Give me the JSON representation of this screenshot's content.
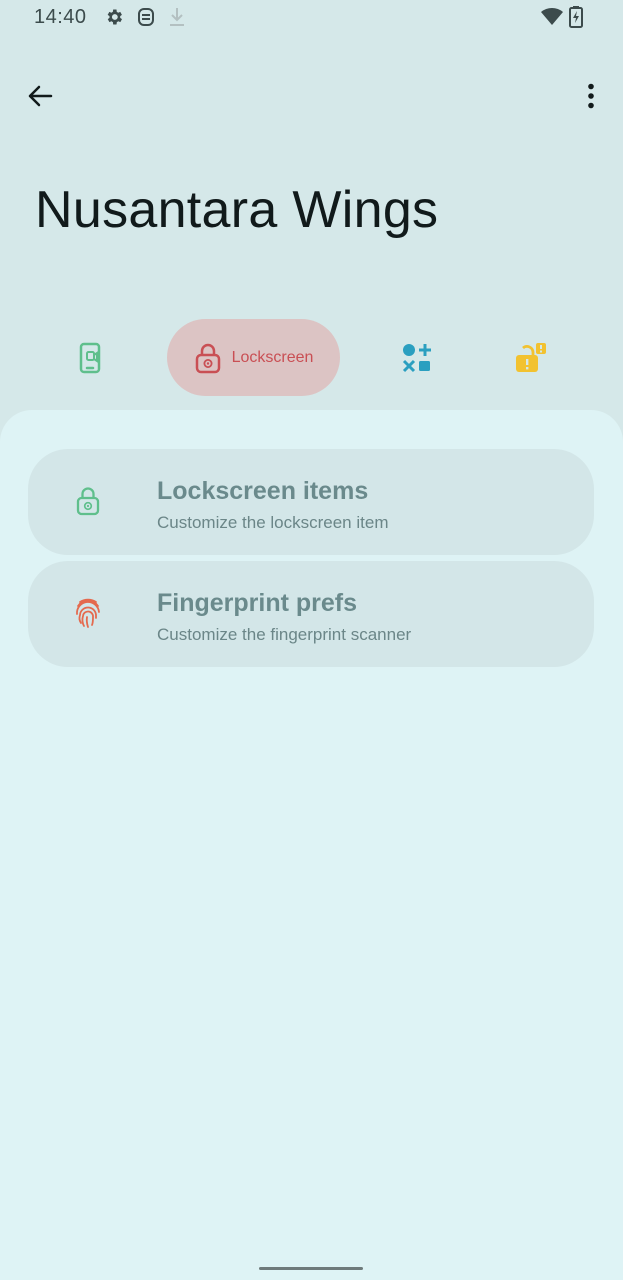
{
  "status_bar": {
    "time": "14:40",
    "icons": [
      "gear-icon",
      "robot-icon",
      "download-icon",
      "wifi-icon",
      "battery-charging-icon"
    ]
  },
  "app_bar": {
    "back_icon": "arrow-back-icon",
    "menu_icon": "more-vert-icon"
  },
  "page": {
    "title": "Nusantara Wings"
  },
  "tabs": [
    {
      "icon": "phone-settings-icon",
      "label": "",
      "active": false,
      "color": "#5fbf8c"
    },
    {
      "icon": "lock-gear-icon",
      "label": "Lockscreen",
      "active": true,
      "color": "#c94f54"
    },
    {
      "icon": "shapes-icon",
      "label": "",
      "active": false,
      "color": "#2a9fc0"
    },
    {
      "icon": "lock-alert-icon",
      "label": "",
      "active": false,
      "color": "#f2c230"
    }
  ],
  "items": [
    {
      "icon": "lock-gear-icon",
      "title": "Lockscreen items",
      "subtitle": "Customize the lockscreen item",
      "icon_color": "#5fbf8c"
    },
    {
      "icon": "fingerprint-icon",
      "title": "Fingerprint prefs",
      "subtitle": "Customize the fingerprint scanner",
      "icon_color": "#e46a4e"
    }
  ],
  "colors": {
    "background": "#d5e8e9",
    "sheet": "#def3f5",
    "card": "#d3e6e8",
    "active_tab": "#dcc4c4"
  }
}
